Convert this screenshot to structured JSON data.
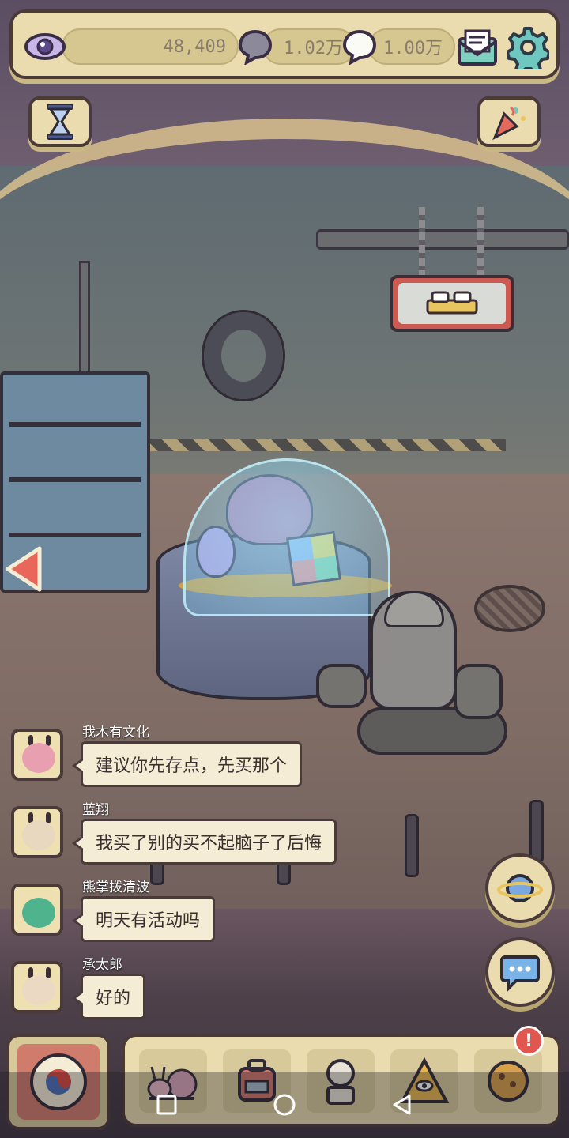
{
  "resources": {
    "eyes": "48,409",
    "bubbles_dark": "1.02万",
    "bubbles_light": "1.00万"
  },
  "chat": [
    {
      "name": "我木有文化",
      "message": "建议你先存点，先买那个"
    },
    {
      "name": "蓝翔",
      "message": "我买了别的买不起脑子了后悔"
    },
    {
      "name": "熊掌拨清波",
      "message": "明天有活动吗"
    },
    {
      "name": "承太郎",
      "message": "好的"
    }
  ],
  "notification_badge": "!",
  "icons": {
    "resource_1": "eye-icon",
    "resource_2": "dark-speech-bubble-icon",
    "resource_3": "white-speech-bubble-icon",
    "mail": "mail-icon",
    "settings": "gear-icon",
    "timer": "hourglass-icon",
    "event": "party-popper-icon",
    "back": "left-arrow-icon",
    "room_sign": "bed-icon",
    "planet": "planet-icon",
    "chat": "chat-icon",
    "main": "taegeuk-eye-icon",
    "nav": [
      "snail-icon",
      "backpack-icon",
      "statue-icon",
      "pyramid-eye-icon",
      "cookie-icon"
    ],
    "system_nav": [
      "square-icon",
      "circle-icon",
      "triangle-back-icon"
    ]
  },
  "colors": {
    "panel": "#eadcae",
    "outline": "#4a3a3a",
    "accent_red": "#e0574f"
  }
}
